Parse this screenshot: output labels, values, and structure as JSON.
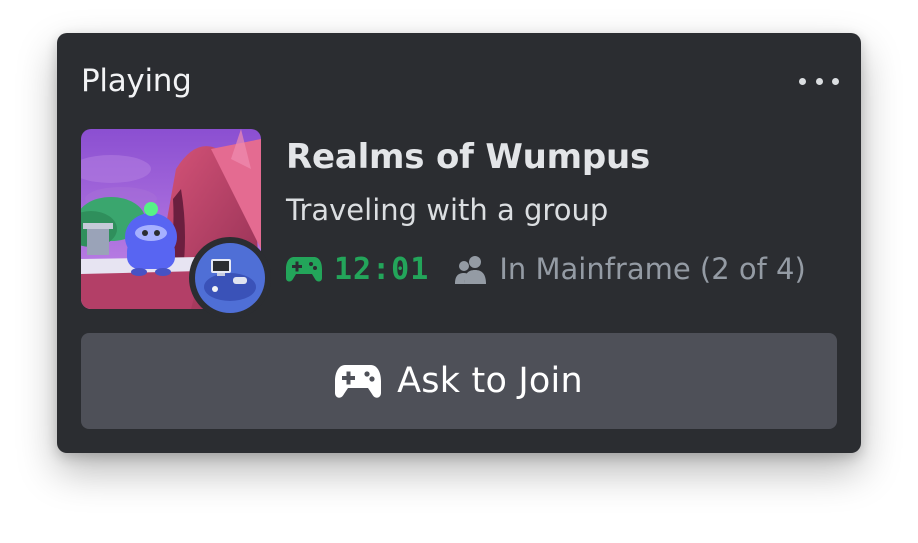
{
  "activity": {
    "header_label": "Playing",
    "more_icon": "more-horizontal-icon",
    "game_title": "Realms of Wumpus",
    "state": "Traveling with a group",
    "elapsed": "12:01",
    "party": "In Mainframe (2 of 4)",
    "join_label": "Ask to Join"
  },
  "icons": {
    "elapsed": "controller-icon",
    "party": "people-icon",
    "join": "controller-icon"
  },
  "colors": {
    "card_bg": "#2b2d31",
    "button_bg": "#4e5058",
    "timer_green": "#23a55a",
    "muted_text": "#949ba4"
  }
}
